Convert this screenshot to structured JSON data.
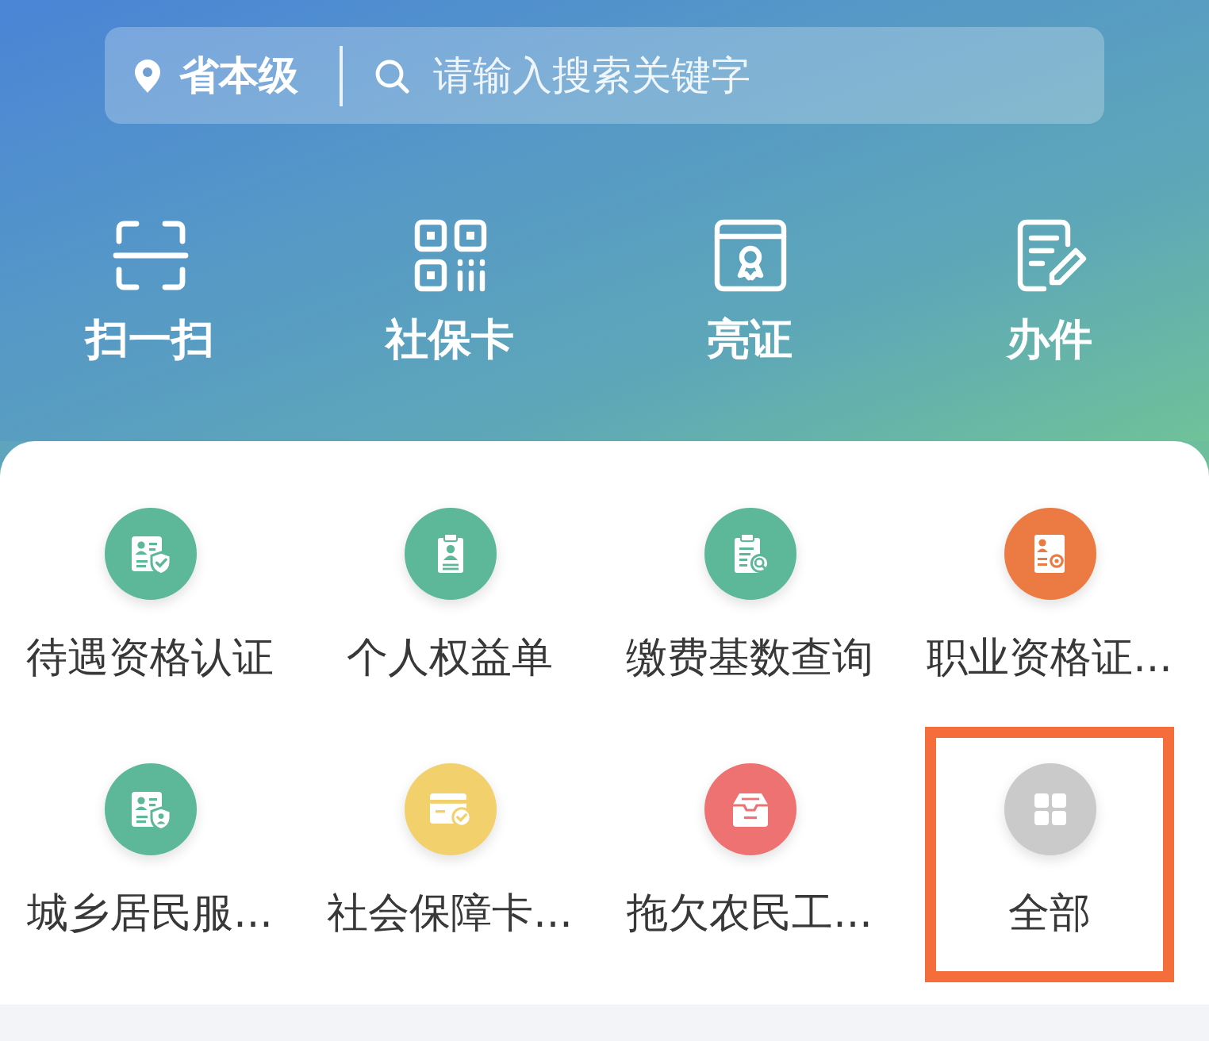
{
  "search_bar": {
    "location": "省本级",
    "placeholder": "请输入搜索关键字"
  },
  "quick_actions": [
    {
      "label": "扫一扫"
    },
    {
      "label": "社保卡"
    },
    {
      "label": "亮证"
    },
    {
      "label": "办件"
    }
  ],
  "services": [
    {
      "label": "待遇资格认证",
      "color": "#5cb899",
      "highlighted": false
    },
    {
      "label": "个人权益单",
      "color": "#5cb899",
      "highlighted": false
    },
    {
      "label": "缴费基数查询",
      "color": "#5cb899",
      "highlighted": false
    },
    {
      "label": "职业资格证...",
      "color": "#ec7b43",
      "highlighted": false
    },
    {
      "label": "城乡居民服...",
      "color": "#5cb899",
      "highlighted": false
    },
    {
      "label": "社会保障卡...",
      "color": "#f2d06c",
      "highlighted": false
    },
    {
      "label": "拖欠农民工...",
      "color": "#ef7272",
      "highlighted": false
    },
    {
      "label": "全部",
      "color": "#cacaca",
      "highlighted": true
    }
  ]
}
